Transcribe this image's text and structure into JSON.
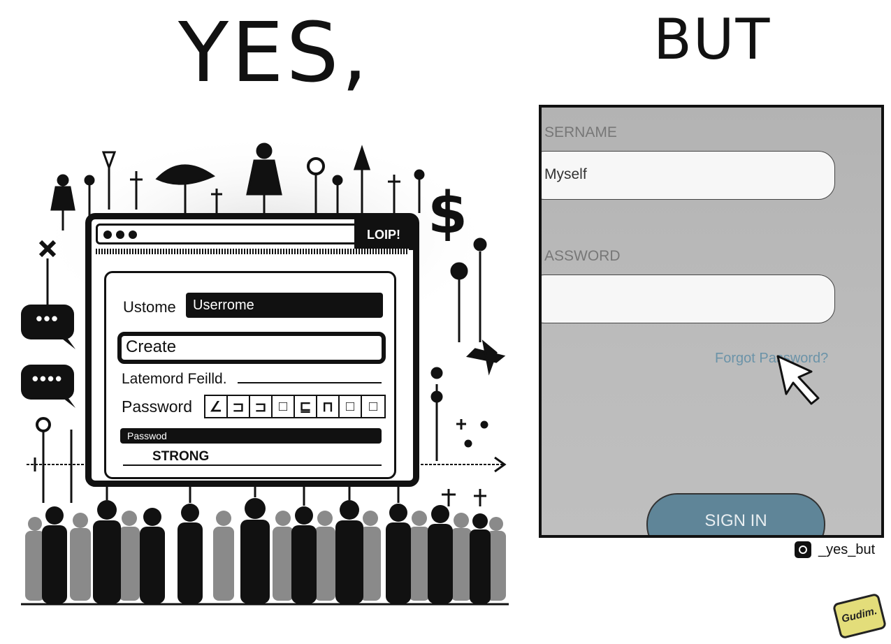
{
  "headings": {
    "left": "YES,",
    "right": "BUT"
  },
  "left_panel": {
    "titlebar_right": "LOIP!",
    "username_label": "Ustome",
    "username_value": "Userrome",
    "create_button": "Create",
    "field_label": "Latemord Feilld.",
    "password_label": "Password",
    "password_cells": [
      "∠",
      "⊐",
      "⊐",
      "□",
      "⊑",
      "⊓",
      "□",
      "□"
    ],
    "strength_bar_label": "Passwod",
    "strength_label": "STRONG",
    "chat_bubble_text": "•••",
    "chat_bubble_text_2": "••••",
    "currency_symbol": "$",
    "icons": [
      "person-icon",
      "fish-icon",
      "airplane-icon",
      "arrow-up-icon",
      "chat-bubble-icon",
      "dollar-icon",
      "close-icon",
      "crowd-icon"
    ]
  },
  "right_panel": {
    "username_label": "SERNAME",
    "username_value": "Myself",
    "password_label": "ASSWORD",
    "password_value": "",
    "forgot_link": "Forgot Password?",
    "sign_in_button": "SIGN IN",
    "colors": {
      "background": "#b8b8b8",
      "button": "#5f8598",
      "link": "#6b93a8"
    }
  },
  "credit": {
    "handle": "_yes_but",
    "logo_text": "Gudim."
  }
}
